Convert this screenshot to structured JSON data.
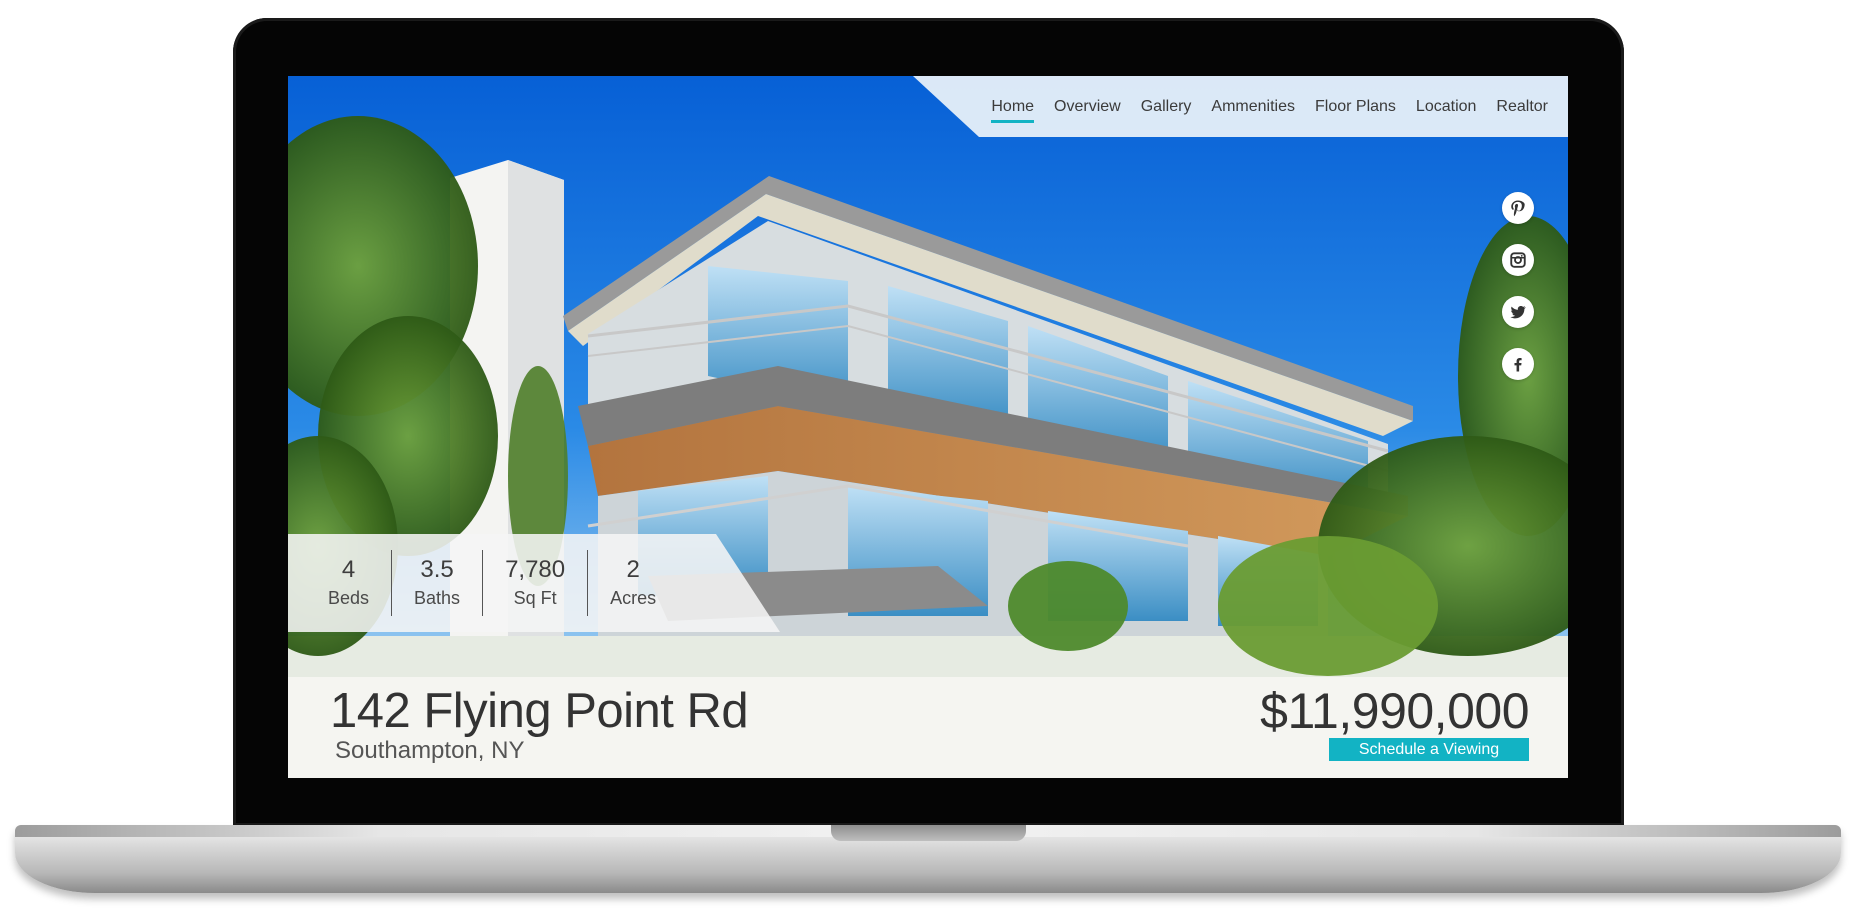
{
  "nav": {
    "items": [
      {
        "label": "Home",
        "active": true
      },
      {
        "label": "Overview"
      },
      {
        "label": "Gallery"
      },
      {
        "label": "Ammenities"
      },
      {
        "label": "Floor Plans"
      },
      {
        "label": "Location"
      },
      {
        "label": "Realtor"
      }
    ]
  },
  "social": {
    "icons": [
      "pinterest-icon",
      "instagram-icon",
      "twitter-icon",
      "facebook-icon"
    ]
  },
  "stats": [
    {
      "value": "4",
      "label": "Beds"
    },
    {
      "value": "3.5",
      "label": "Baths"
    },
    {
      "value": "7,780",
      "label": "Sq Ft"
    },
    {
      "value": "2",
      "label": "Acres"
    }
  ],
  "listing": {
    "address": "142 Flying Point Rd",
    "city": "Southampton, NY",
    "price": "$11,990,000",
    "cta_label": "Schedule a Viewing"
  },
  "colors": {
    "accent": "#12b3c4",
    "text_dark": "#333333",
    "nav_bg": "#eef4fa"
  }
}
